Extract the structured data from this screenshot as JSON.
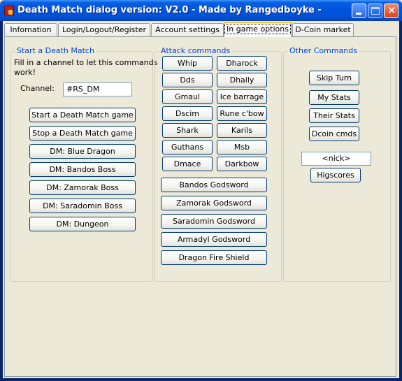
{
  "window": {
    "title": "Death Match dialog version: V2.0 - Made by Rangedboyke -",
    "controls": {
      "minimize": "minimize",
      "maximize": "maximize",
      "close": "✕"
    }
  },
  "tabs": [
    {
      "label": "Infomation",
      "active": false
    },
    {
      "label": "Login/Logout/Register",
      "active": false
    },
    {
      "label": "Account settings",
      "active": false
    },
    {
      "label": "In game options",
      "active": true
    },
    {
      "label": "D-Coin market",
      "active": false
    }
  ],
  "start_group": {
    "title": "Start a Death Match",
    "hint_line1": "Fill in a channel to let this commands",
    "hint_line2": "work!",
    "channel_label": "Channel:",
    "channel_value": "#RS_DM",
    "buttons": [
      "Start a Death Match game",
      "Stop a Death Match game",
      "DM: Blue Dragon",
      "DM: Bandos Boss",
      "DM: Zamorak Boss",
      "DM: Saradomin Boss",
      "DM: Dungeon"
    ]
  },
  "attack_group": {
    "title": "Attack commands",
    "left_buttons": [
      "Whip",
      "Dds",
      "Gmaul",
      "Dscim",
      "Shark",
      "Guthans",
      "Dmace"
    ],
    "right_buttons": [
      "Dharock",
      "Dhally",
      "Ice barrage",
      "Rune c'bow",
      "Karils",
      "Msb",
      "Darkbow"
    ],
    "wide_buttons": [
      "Bandos Godsword",
      "Zamorak Godsword",
      "Saradomin Godsword",
      "Armadyl Godsword",
      "Dragon Fire Shield"
    ]
  },
  "other_group": {
    "title": "Other Commands",
    "buttons": [
      "Skip Turn",
      "My Stats",
      "Their Stats",
      "Dcoin cmds"
    ],
    "nick_value": "<nick>",
    "highscores_label": "Higscores"
  },
  "colors": {
    "titlebar": "#0054e3",
    "group_title": "#0046d5",
    "panel_bg": "#ece9d8",
    "active_tab_accent": "#ffc83c"
  }
}
